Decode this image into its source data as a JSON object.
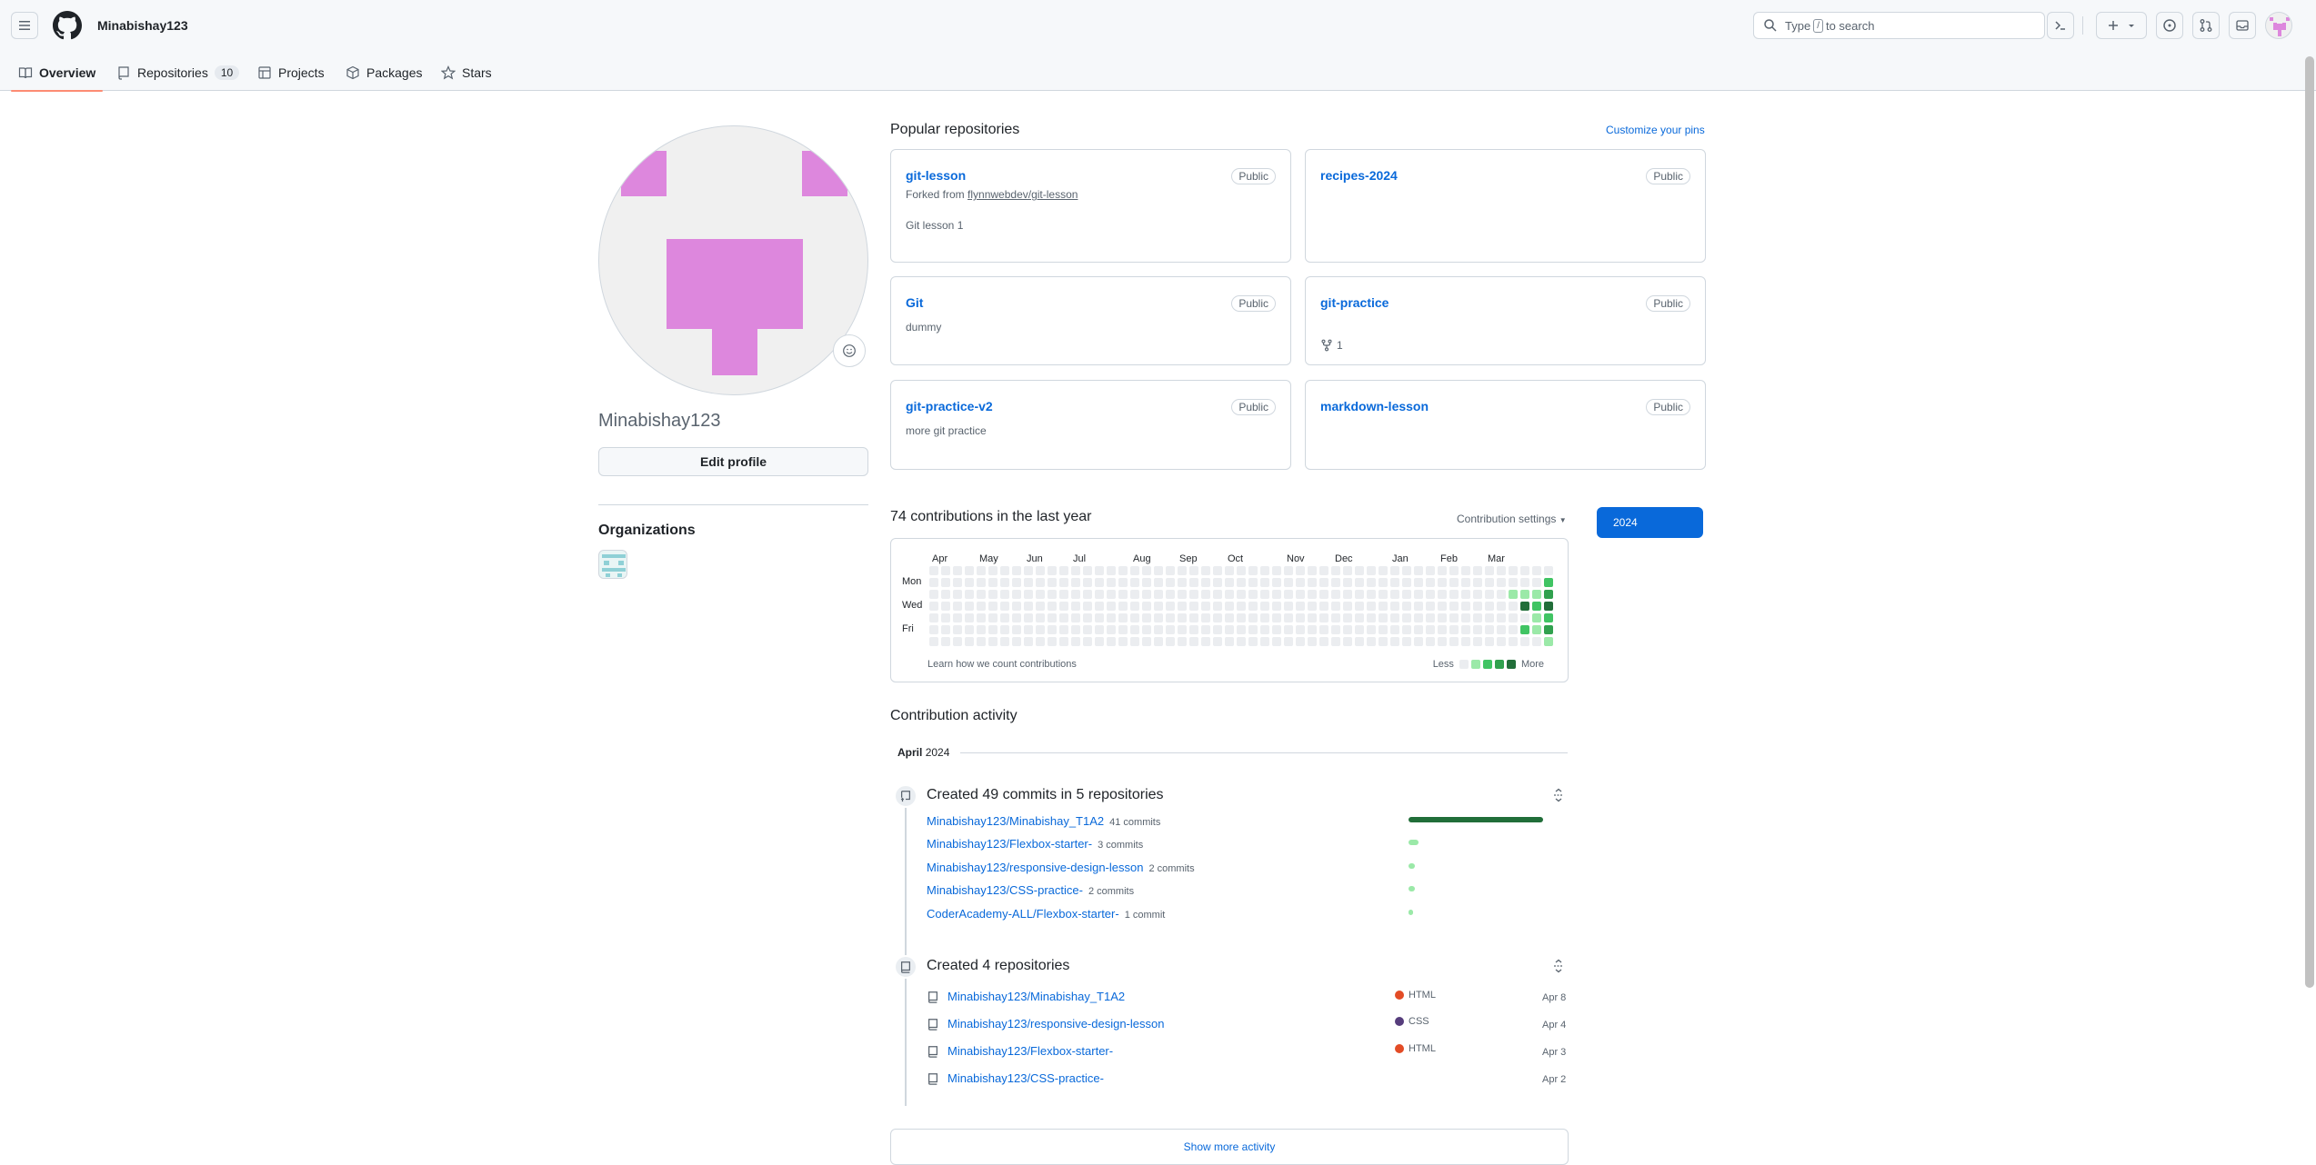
{
  "header": {
    "username": "Minabishay123",
    "search": {
      "prefix": "Type",
      "key": "/",
      "suffix": "to search"
    }
  },
  "nav": {
    "tabs": [
      {
        "label": "Overview"
      },
      {
        "label": "Repositories",
        "count": "10"
      },
      {
        "label": "Projects"
      },
      {
        "label": "Packages"
      },
      {
        "label": "Stars"
      }
    ]
  },
  "profile": {
    "name": "Minabishay123",
    "edit_label": "Edit profile",
    "organizations_title": "Organizations"
  },
  "pinned": {
    "title": "Popular repositories",
    "customize": "Customize your pins",
    "repos": [
      {
        "name": "git-lesson",
        "visibility": "Public",
        "fork_prefix": "Forked from",
        "fork_source": "flynnwebdev/git-lesson",
        "description": "Git lesson 1"
      },
      {
        "name": "recipes-2024",
        "visibility": "Public"
      },
      {
        "name": "Git",
        "visibility": "Public",
        "description": "dummy"
      },
      {
        "name": "git-practice",
        "visibility": "Public",
        "forks": "1"
      },
      {
        "name": "git-practice-v2",
        "visibility": "Public",
        "description": "more git practice"
      },
      {
        "name": "markdown-lesson",
        "visibility": "Public"
      }
    ]
  },
  "contributions": {
    "title": "74 contributions in the last year",
    "settings": "Contribution settings",
    "year": "2024",
    "months": [
      "Apr",
      "May",
      "Jun",
      "Jul",
      "Aug",
      "Sep",
      "Oct",
      "Nov",
      "Dec",
      "Jan",
      "Feb",
      "Mar"
    ],
    "day_labels": [
      "Mon",
      "Wed",
      "Fri"
    ],
    "learn": "Learn how we count contributions",
    "less": "Less",
    "more": "More",
    "colors": [
      "#ebedf0",
      "#9be9a8",
      "#40c463",
      "#30a14e",
      "#216e39"
    ]
  },
  "activity": {
    "title": "Contribution activity",
    "month": "April",
    "year": "2024",
    "commits_title": "Created 49 commits in 5 repositories",
    "commits": [
      {
        "repo": "Minabishay123/Minabishay_T1A2",
        "count": "41 commits",
        "value": 41
      },
      {
        "repo": "Minabishay123/Flexbox-starter-",
        "count": "3 commits",
        "value": 3
      },
      {
        "repo": "Minabishay123/responsive-design-lesson",
        "count": "2 commits",
        "value": 2
      },
      {
        "repo": "Minabishay123/CSS-practice-",
        "count": "2 commits",
        "value": 2
      },
      {
        "repo": "CoderAcademy-ALL/Flexbox-starter-",
        "count": "1 commit",
        "value": 1
      }
    ],
    "repos_title": "Created 4 repositories",
    "created": [
      {
        "repo": "Minabishay123/Minabishay_T1A2",
        "language": "HTML",
        "lang_color": "#e34c26",
        "date": "Apr 8"
      },
      {
        "repo": "Minabishay123/responsive-design-lesson",
        "language": "CSS",
        "lang_color": "#563d7c",
        "date": "Apr 4"
      },
      {
        "repo": "Minabishay123/Flexbox-starter-",
        "language": "HTML",
        "lang_color": "#e34c26",
        "date": "Apr 3"
      },
      {
        "repo": "Minabishay123/CSS-practice-",
        "language": "",
        "lang_color": "",
        "date": "Apr 2"
      }
    ],
    "show_more": "Show more activity"
  }
}
